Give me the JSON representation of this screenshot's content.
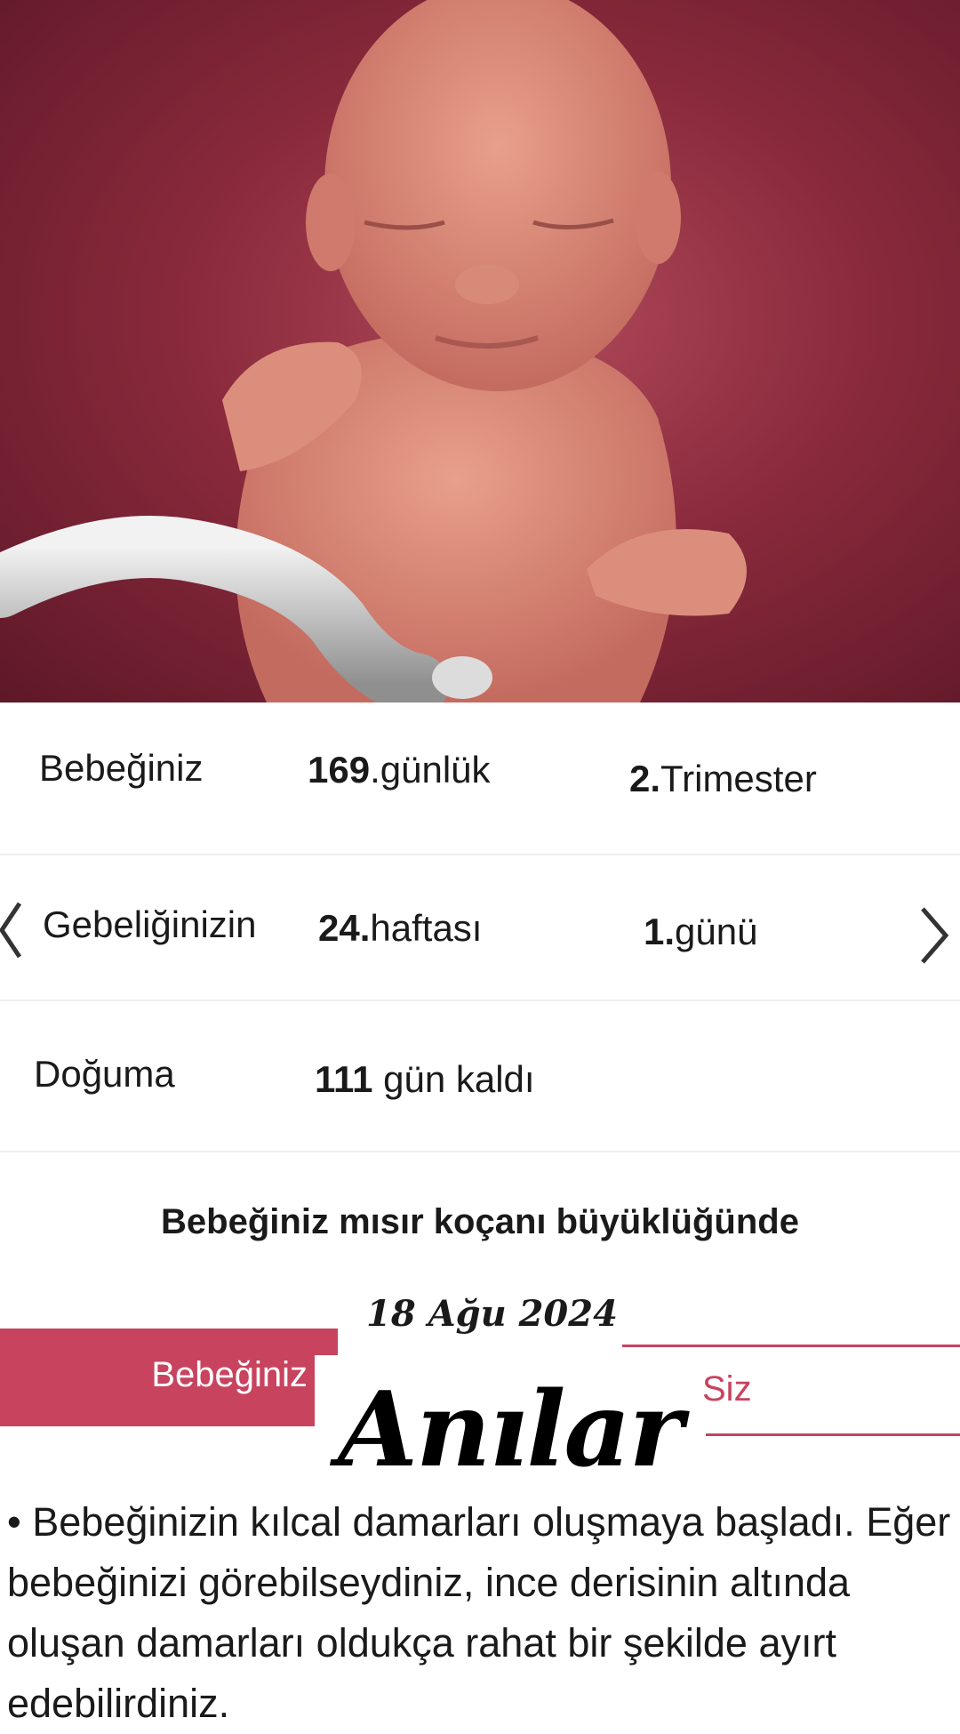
{
  "stats": {
    "row1": {
      "label": "Bebeğiniz",
      "days_num": "169",
      "days_suffix": ".günlük",
      "tri_num": "2.",
      "tri_suffix": "Trimester"
    },
    "row2": {
      "label": "Gebeliğinizin",
      "week_num": "24.",
      "week_suffix": "haftası",
      "day_num": "1.",
      "day_suffix": "günü"
    },
    "row3": {
      "label": "Doğuma",
      "remaining_num": "111",
      "remaining_suffix": " gün kaldı"
    }
  },
  "size_title": "Bebeğiniz mısır koçanı büyüklüğünde",
  "date": "18 Ağu 2024",
  "tabs": {
    "baby": "Bebeğiniz",
    "you": "Siz"
  },
  "overlay_title": "Anılar",
  "body": "• Bebeğinizin kılcal damarları oluşmaya başladı. Eğer bebeğinizi görebilseydiniz, ince derisinin altında oluşan damarları oldukça rahat bir şekilde ayırt edebilirdiniz.",
  "colors": {
    "accent": "#c8435e",
    "hero_bg": "#8a2a3c"
  },
  "icons": {
    "prev": "chevron-left-icon",
    "next": "chevron-right-icon"
  }
}
